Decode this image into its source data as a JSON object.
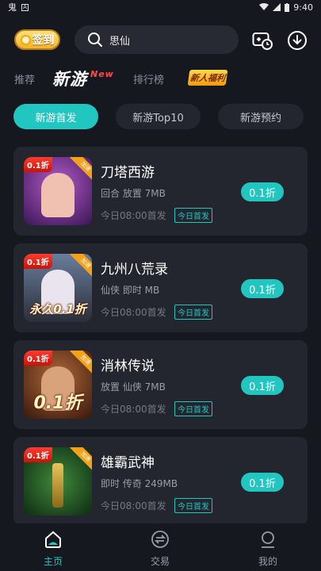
{
  "status": {
    "left_icons": [
      "app-icon",
      "a-icon"
    ],
    "time": "9:40"
  },
  "header": {
    "signin_label": "签到",
    "search_value": "思仙"
  },
  "nav": {
    "recommend": "推荐",
    "newgame": "新游",
    "newgame_tag": "New",
    "ranking": "排行榜",
    "newplayer": "新人福利"
  },
  "tabs": [
    {
      "label": "新游首发",
      "active": true
    },
    {
      "label": "新游Top10",
      "active": false
    },
    {
      "label": "新游预约",
      "active": false
    }
  ],
  "games": [
    {
      "title": "刀塔西游",
      "tags": "回合 放置 7MB",
      "date": "今日08:00首发",
      "badge": "今日首发",
      "discount": "0.1折",
      "thumb_badge": "0.1折",
      "thumb_ribbon": "加速",
      "thumb_text": "",
      "color_bg": "#5a2a86",
      "color_fig": "#d77ad6"
    },
    {
      "title": "九州八荒录",
      "tags": "仙侠 即时 MB",
      "date": "今日08:00首发",
      "badge": "今日首发",
      "discount": "0.1折",
      "thumb_badge": "0.1折",
      "thumb_ribbon": "加速",
      "thumb_text": "永久0.1折",
      "color_bg": "#3b4c67",
      "color_fig": "#e9e3ec"
    },
    {
      "title": "消林传说",
      "tags": "放置 仙侠 7MB",
      "date": "今日08:00首发",
      "badge": "今日首发",
      "discount": "0.1折",
      "thumb_badge": "0.1折",
      "thumb_ribbon": "加速",
      "thumb_text": "0.1折",
      "color_bg": "#5e2f1d",
      "color_fig": "#c08a6a"
    },
    {
      "title": "雄霸武神",
      "tags": "即时 传奇 249MB",
      "date": "今日08:00首发",
      "badge": "今日首发",
      "discount": "0.1折",
      "thumb_badge": "0.1折",
      "thumb_ribbon": "加速",
      "thumb_text": "",
      "color_bg": "#1f4f22",
      "color_fig": "#c8a33a"
    }
  ],
  "bottom_nav": [
    {
      "label": "主页",
      "icon": "home-icon",
      "active": true
    },
    {
      "label": "交易",
      "icon": "exchange-icon",
      "active": false
    },
    {
      "label": "我的",
      "icon": "profile-icon",
      "active": false
    }
  ],
  "colors": {
    "accent": "#22c6c1",
    "card": "#23262e",
    "background": "#16181f"
  }
}
